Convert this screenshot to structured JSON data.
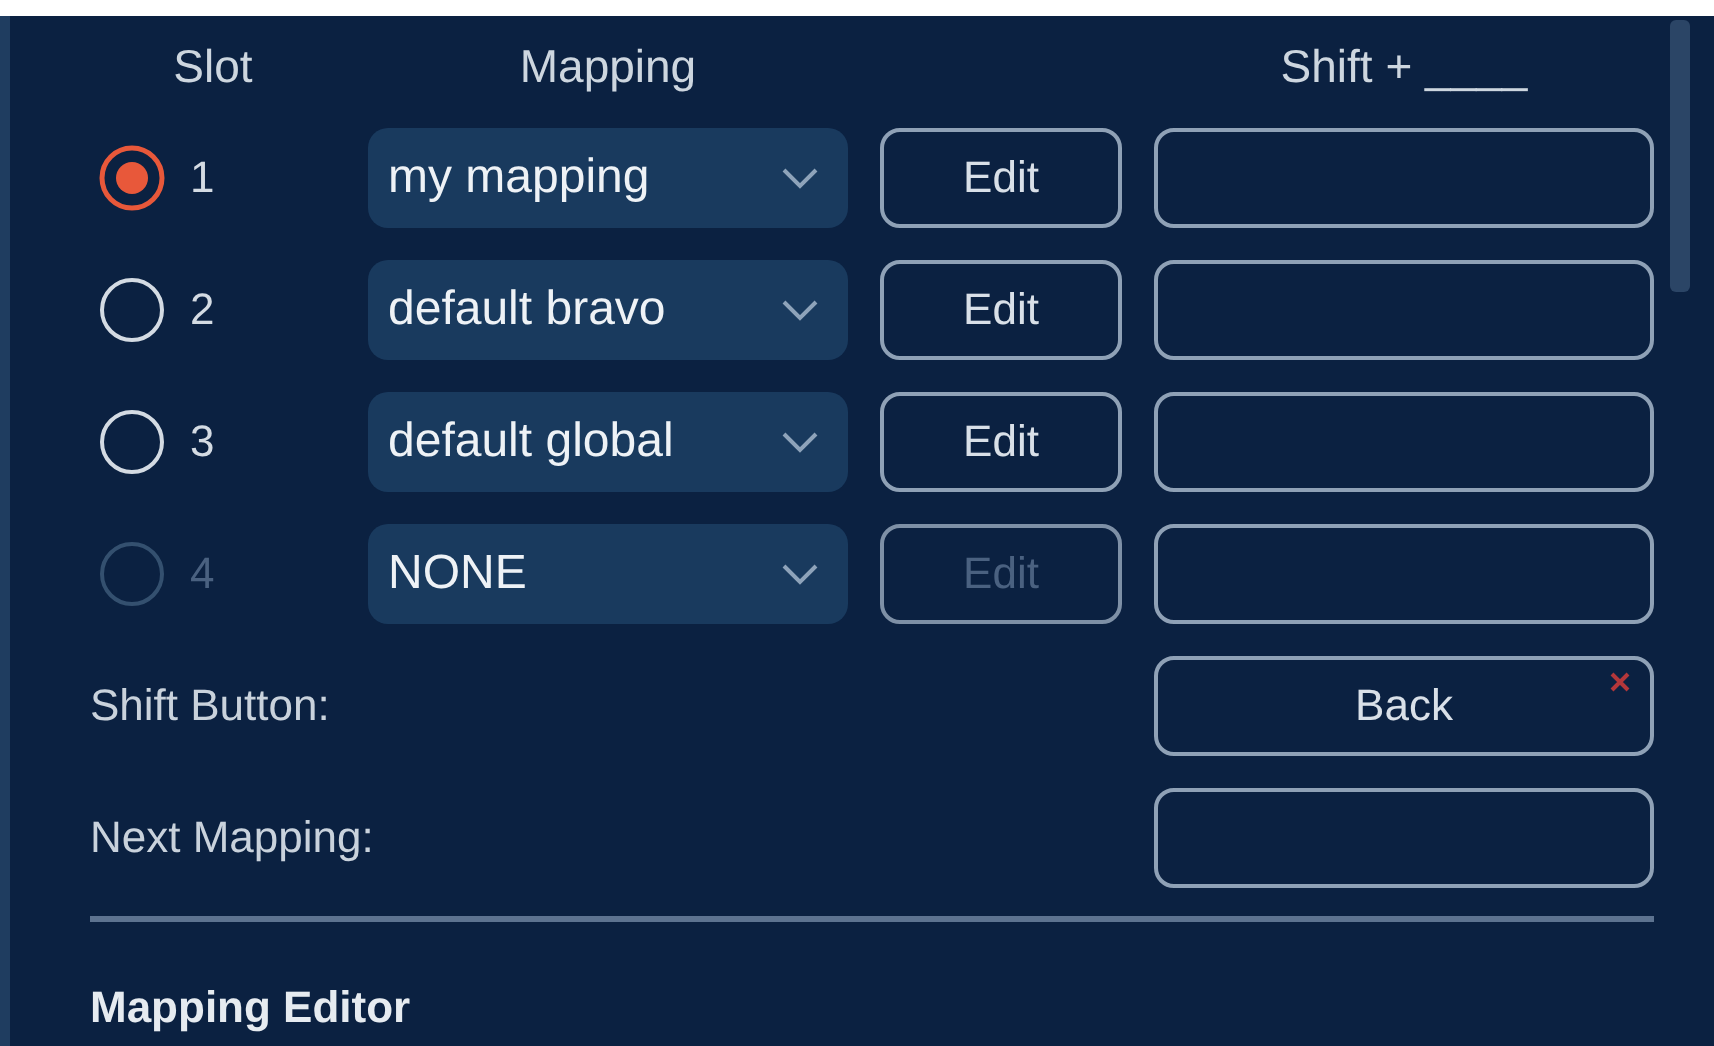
{
  "headers": {
    "slot": "Slot",
    "mapping": "Mapping",
    "shift": "Shift + ____"
  },
  "slots": [
    {
      "number": "1",
      "selected": true,
      "disabled": false,
      "mapping": "my mapping",
      "edit": "Edit"
    },
    {
      "number": "2",
      "selected": false,
      "disabled": false,
      "mapping": "default bravo",
      "edit": "Edit"
    },
    {
      "number": "3",
      "selected": false,
      "disabled": false,
      "mapping": "default global",
      "edit": "Edit"
    },
    {
      "number": "4",
      "selected": false,
      "disabled": true,
      "mapping": "NONE",
      "edit": "Edit"
    }
  ],
  "shift_button": {
    "label": "Shift Button:",
    "value": "Back"
  },
  "next_mapping": {
    "label": "Next Mapping:"
  },
  "section_title": "Mapping Editor"
}
